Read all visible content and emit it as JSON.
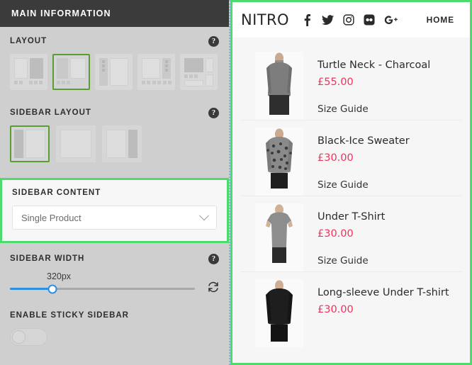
{
  "settings_panel": {
    "header_title": "MAIN INFORMATION",
    "layout": {
      "label": "LAYOUT",
      "help_icon": "question-mark-icon",
      "help_glyph": "?",
      "selected_index": 1,
      "options": [
        "layout-1",
        "layout-2",
        "layout-3",
        "layout-4",
        "layout-5"
      ]
    },
    "sidebar_layout": {
      "label": "SIDEBAR LAYOUT",
      "help_glyph": "?",
      "selected_index": 0,
      "options": [
        "sidebar-left",
        "sidebar-none",
        "sidebar-right"
      ]
    },
    "sidebar_content": {
      "label": "SIDEBAR CONTENT",
      "selected_value": "Single Product",
      "chevron_icon": "chevron-down-icon",
      "highlight_color": "#4ddc6b"
    },
    "sidebar_width": {
      "label": "SIDEBAR WIDTH",
      "help_glyph": "?",
      "value": "320px",
      "slider_percent": 23,
      "accent_color": "#2e8fe0",
      "reset_icon": "refresh-icon"
    },
    "enable_sticky_sidebar": {
      "label": "ENABLE STICKY SIDEBAR",
      "state": "off"
    }
  },
  "preview": {
    "brand": "NITRO",
    "nav_home": "HOME",
    "socials": [
      {
        "name": "facebook-icon"
      },
      {
        "name": "twitter-icon"
      },
      {
        "name": "instagram-icon"
      },
      {
        "name": "flickr-icon"
      },
      {
        "name": "google-plus-icon"
      }
    ],
    "size_guide_label": "Size Guide",
    "products": [
      {
        "name": "Turtle Neck - Charcoal",
        "price": "£55.00",
        "size_guide": "Size Guide",
        "image": "turtle-neck-charcoal-photo"
      },
      {
        "name": "Black-Ice Sweater",
        "price": "£30.00",
        "size_guide": "Size Guide",
        "image": "black-ice-sweater-photo"
      },
      {
        "name": "Under T-Shirt",
        "price": "£30.00",
        "size_guide": "Size Guide",
        "image": "under-tshirt-photo"
      },
      {
        "name": "Long-sleeve Under T-shirt",
        "price": "£30.00",
        "size_guide": "",
        "image": "long-sleeve-under-tshirt-photo"
      }
    ]
  }
}
